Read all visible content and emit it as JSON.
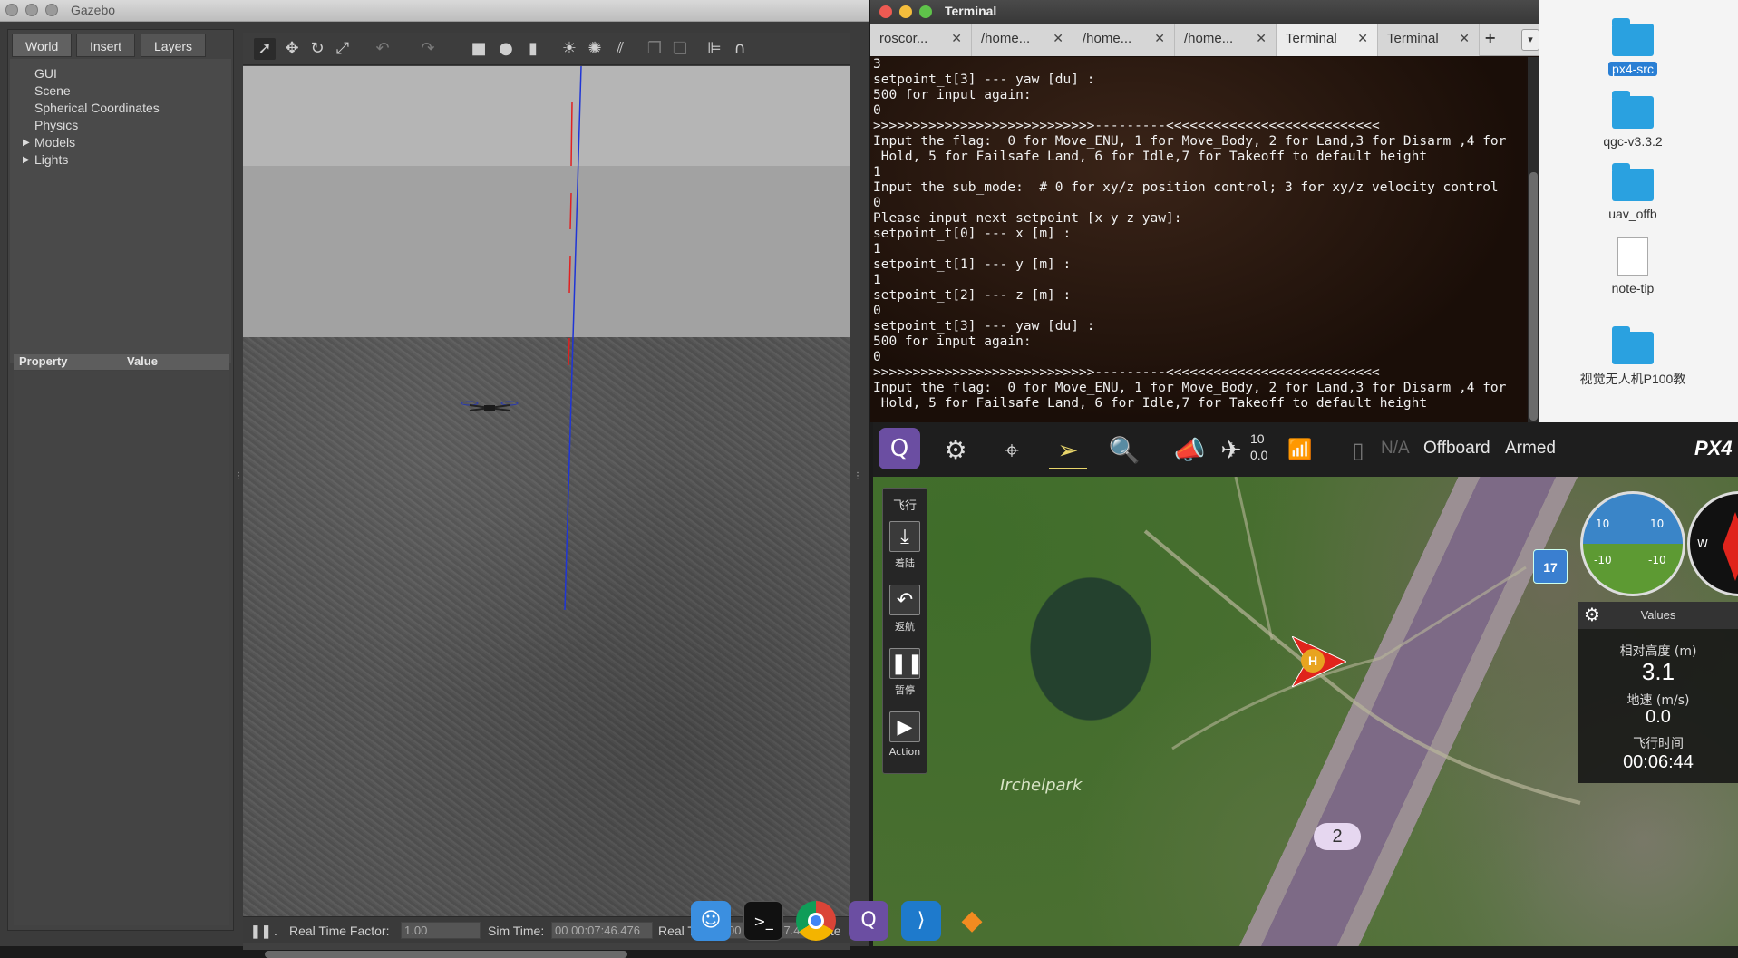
{
  "gazebo": {
    "title": "Gazebo",
    "tabs": [
      "World",
      "Insert",
      "Layers"
    ],
    "tree": [
      "GUI",
      "Scene",
      "Spherical Coordinates",
      "Physics",
      "Models",
      "Lights"
    ],
    "property_header": "Property",
    "value_header": "Value",
    "status": {
      "real_time_factor_label": "Real Time Factor:",
      "real_time_factor": "1.00",
      "sim_time_label": "Sim Time:",
      "sim_time": "00 00:07:46.476",
      "real_time_label": "Real Time:",
      "real_time": "00 00:07:47.49",
      "iterations_label": "Ite"
    }
  },
  "terminal": {
    "title": "Terminal",
    "tabs": [
      "roscor...",
      "/home...",
      "/home...",
      "/home...",
      "Terminal",
      "Terminal"
    ],
    "active_tab": 4,
    "add_tab": "+",
    "menu": "▾",
    "lines": [
      "3",
      "setpoint_t[3] --- yaw [du] :",
      "500 for input again:",
      "0",
      ">>>>>>>>>>>>>>>>>>>>>>>>>>>>---------<<<<<<<<<<<<<<<<<<<<<<<<<<<",
      "Input the flag:  0 for Move_ENU, 1 for Move_Body, 2 for Land,3 for Disarm ,4 for",
      " Hold, 5 for Failsafe Land, 6 for Idle,7 for Takeoff to default height",
      "1",
      "Input the sub_mode:  # 0 for xy/z position control; 3 for xy/z velocity control",
      "0",
      "Please input next setpoint [x y z yaw]:",
      "setpoint_t[0] --- x [m] :",
      "1",
      "setpoint_t[1] --- y [m] :",
      "1",
      "setpoint_t[2] --- z [m] :",
      "0",
      "setpoint_t[3] --- yaw [du] :",
      "500 for input again:",
      "0",
      ">>>>>>>>>>>>>>>>>>>>>>>>>>>>---------<<<<<<<<<<<<<<<<<<<<<<<<<<<",
      "Input the flag:  0 for Move_ENU, 1 for Move_Body, 2 for Land,3 for Disarm ,4 for",
      " Hold, 5 for Failsafe Land, 6 for Idle,7 for Takeoff to default height"
    ]
  },
  "desktop": {
    "items": [
      {
        "label": "px4-src",
        "type": "folder",
        "selected": true
      },
      {
        "label": "qgc-v3.3.2",
        "type": "folder",
        "selected": false
      },
      {
        "label": "uav_offb",
        "type": "folder",
        "selected": false
      },
      {
        "label": "note-tip",
        "type": "file",
        "selected": false
      },
      {
        "label": "视觉无人机P100教",
        "type": "folder",
        "selected": false
      }
    ]
  },
  "qgc": {
    "satellites": "10",
    "hdop": "0.0",
    "battery": "N/A",
    "flight_mode": "Offboard",
    "arm_state": "Armed",
    "brand": "PX4",
    "side": {
      "title": "飞行",
      "land": "着陆",
      "rtl": "返航",
      "pause": "暂停",
      "action": "Action"
    },
    "values": {
      "header": "Values",
      "rel_alt_label": "相对高度 (m)",
      "rel_alt": "3.1",
      "ground_speed_label": "地速 (m/s)",
      "ground_speed": "0.0",
      "flight_time_label": "飞行时间",
      "flight_time": "00:06:44"
    },
    "badge": "17",
    "waypoint": "2",
    "home": "H",
    "map_label": "Irchelpark",
    "attitude_ticks": [
      "10",
      "10",
      "-10",
      "-10"
    ],
    "compass_w": "W"
  },
  "colors": {
    "terminal_bg": "#1a0f0a",
    "qgc_accent": "#6b4ea2",
    "vehicle_red": "#e0241c"
  }
}
